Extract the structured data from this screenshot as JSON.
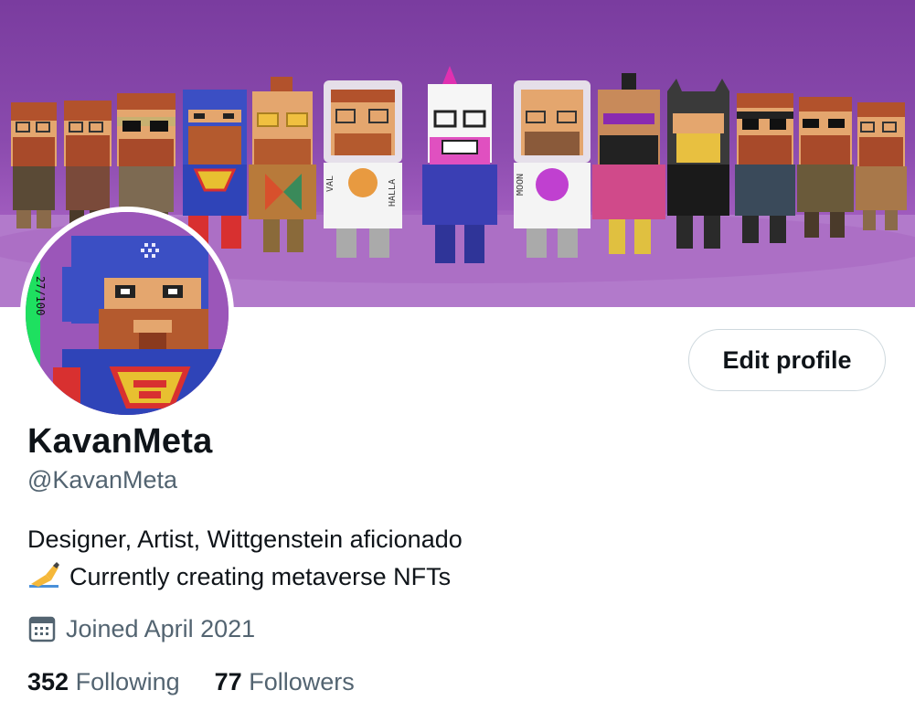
{
  "profile": {
    "display_name": "KavanMeta",
    "handle": "@KavanMeta",
    "bio_line1": "Designer, Artist, Wittgenstein aficionado",
    "bio_line2": "Currently creating metaverse NFTs",
    "bio_emoji": "writing-hand-icon",
    "joined": "Joined April 2021",
    "avatar_badge_text": "27/100"
  },
  "stats": {
    "following_count": "352",
    "following_label": "Following",
    "followers_count": "77",
    "followers_label": "Followers"
  },
  "actions": {
    "edit_profile_label": "Edit profile"
  },
  "banner": {
    "figure_labels": [
      "VAL",
      "HALLA",
      "MOON"
    ]
  },
  "colors": {
    "banner_purple": "#8a4aad",
    "text_primary": "#0f1419",
    "text_secondary": "#536471",
    "button_border": "#cfd9de"
  }
}
